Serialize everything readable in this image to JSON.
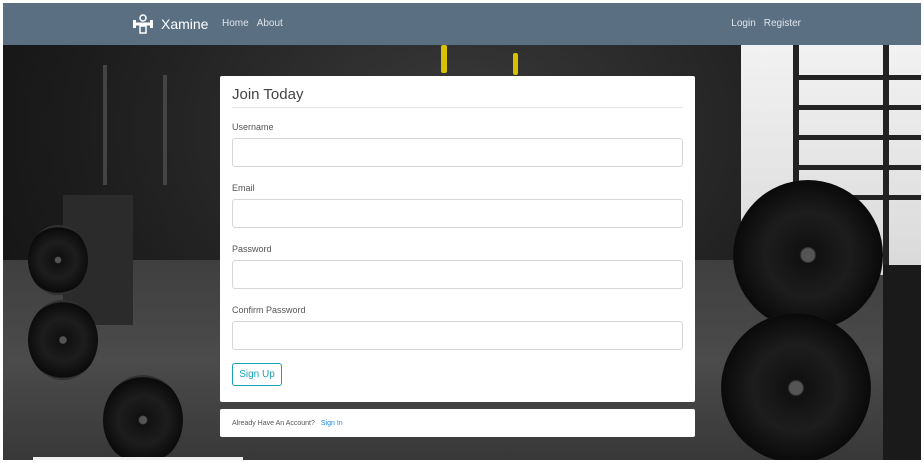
{
  "brand": {
    "name": "Xamine",
    "logo_icon": "dumbbell-logo-icon"
  },
  "nav": {
    "left": [
      {
        "label": "Home"
      },
      {
        "label": "About"
      }
    ],
    "right": [
      {
        "label": "Login"
      },
      {
        "label": "Register"
      }
    ]
  },
  "form": {
    "title": "Join Today",
    "fields": [
      {
        "label": "Username",
        "value": "",
        "placeholder": ""
      },
      {
        "label": "Email",
        "value": "",
        "placeholder": ""
      },
      {
        "label": "Password",
        "value": "",
        "placeholder": ""
      },
      {
        "label": "Confirm Password",
        "value": "",
        "placeholder": ""
      }
    ],
    "submit_label": "Sign Up"
  },
  "account": {
    "prompt": "Already Have An Account?",
    "link_label": "Sign In"
  },
  "colors": {
    "navbar": "#5b6f82",
    "accent": "#17a2b8",
    "link": "#1e88e5"
  }
}
